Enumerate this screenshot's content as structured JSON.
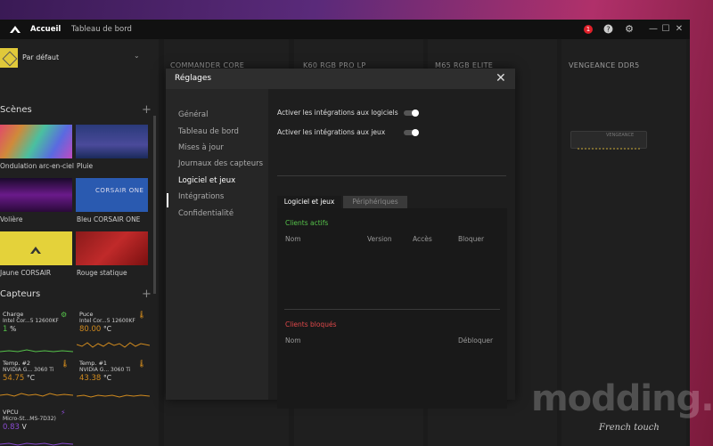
{
  "topbar": {
    "tabs": [
      {
        "label": "Accueil"
      },
      {
        "label": "Tableau de bord"
      }
    ],
    "alert_count": "1",
    "icons": [
      "corsair-logo-icon",
      "help-icon",
      "gear-icon"
    ],
    "window_controls": [
      "—",
      "☐",
      "✕"
    ]
  },
  "sidebar": {
    "profile": "Par défaut",
    "scenes_title": "Scènes",
    "scenes": [
      {
        "label": "Ondulation arc-en-ciel"
      },
      {
        "label": "Pluie"
      },
      {
        "label": "Volière"
      },
      {
        "label": "Bleu CORSAIR ONE",
        "tile_text": "CORSAIR ONE"
      },
      {
        "label": "Jaune CORSAIR"
      },
      {
        "label": "Rouge statique"
      }
    ],
    "sensors_title": "Capteurs",
    "sensors": [
      {
        "title": "Charge",
        "device": "Intel Cor...5 12600KF",
        "value": "1",
        "unit": "%",
        "color": "#55c24a"
      },
      {
        "title": "Puce",
        "device": "Intel Cor...5 12600KF",
        "value": "80.00",
        "unit": "°C",
        "color": "#d08a1e"
      },
      {
        "title": "Temp. #2",
        "device": "NVIDIA G... 3060 Ti",
        "value": "54.75",
        "unit": "°C",
        "color": "#d08a1e"
      },
      {
        "title": "Temp. #1",
        "device": "NVIDIA G... 3060 Ti",
        "value": "43.38",
        "unit": "°C",
        "color": "#d08a1e"
      },
      {
        "title": "VPCU",
        "device": "Micro-St...MS-7D32)",
        "value": "0.83",
        "unit": "V",
        "color": "#8a4ad0"
      }
    ]
  },
  "devices": [
    {
      "name": "COMMANDER CORE"
    },
    {
      "name": "K60 RGB PRO LP"
    },
    {
      "name": "M65 RGB ELITE"
    },
    {
      "name": "VENGEANCE DDR5",
      "label": "VENGEANCE"
    }
  ],
  "modal": {
    "title": "Réglages",
    "nav": [
      {
        "label": "Général"
      },
      {
        "label": "Tableau de bord"
      },
      {
        "label": "Mises à jour"
      },
      {
        "label": "Journaux des capteurs"
      },
      {
        "label": "Logiciel et jeux"
      },
      {
        "label": "Intégrations"
      },
      {
        "label": "Confidentialité"
      }
    ],
    "toggles": [
      {
        "label": "Activer les intégrations aux logiciels"
      },
      {
        "label": "Activer les intégrations aux jeux"
      }
    ],
    "tabs": [
      {
        "label": "Logiciel et jeux"
      },
      {
        "label": "Périphériques"
      }
    ],
    "active_clients": {
      "title": "Clients actifs",
      "columns": [
        "Nom",
        "Version",
        "Accès",
        "Bloquer"
      ]
    },
    "blocked_clients": {
      "title": "Clients bloqués",
      "columns": [
        "Nom",
        "Débloquer"
      ]
    }
  },
  "watermark": {
    "main": "modding.fr",
    "sub": "French touch"
  }
}
